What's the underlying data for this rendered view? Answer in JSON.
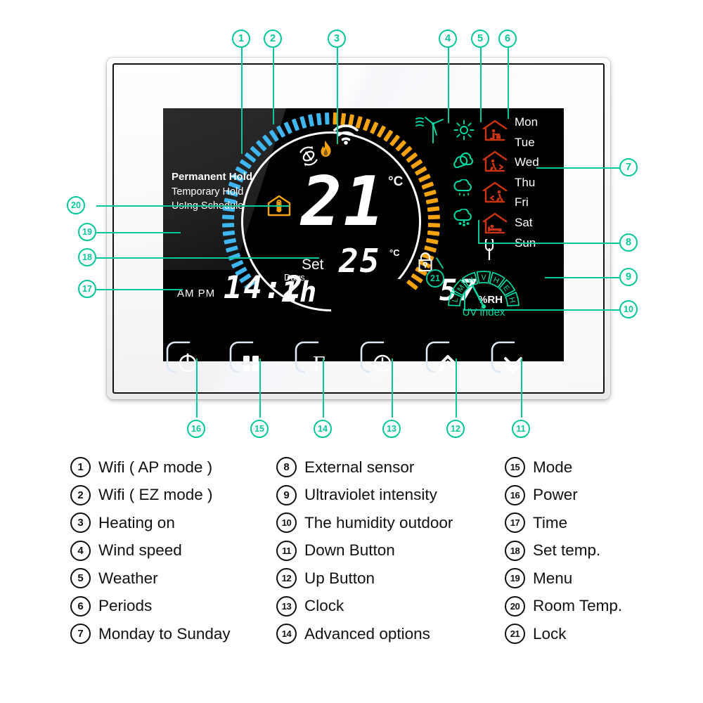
{
  "device": {
    "screen": {
      "room_temperature": "21",
      "room_temperature_unit": "°C",
      "set_label": "Set",
      "set_temperature": "25",
      "set_temperature_unit": "°C",
      "ampm_label": "AM PM",
      "clock_time": "14:2",
      "days_label": "Days",
      "days_value": "1h",
      "humidity_value": "57",
      "humidity_unit": "%RH",
      "uv_label": "UV index",
      "uv_scale": [
        "L",
        "M",
        "H",
        "V",
        "H",
        "E",
        "H"
      ],
      "menu_modes": [
        "Permanent Hold",
        "Temporary Hold",
        "UsIng Schedule"
      ],
      "weekdays": [
        "Mon",
        "Tue",
        "Wed",
        "Thu",
        "Fri",
        "Sat",
        "Sun"
      ],
      "weather_icons": [
        "sun-icon",
        "cloud-icon",
        "rain-cloud-icon",
        "snow-cloud-icon"
      ],
      "period_icons": [
        "period-wake-icon",
        "period-leave-icon",
        "period-return-icon",
        "period-sleep-icon"
      ],
      "status_icons": [
        "wifi-ap-mode-icon",
        "wifi-ez-mode-icon",
        "flame-heating-icon",
        "room-temp-house-icon",
        "wind-turbine-icon",
        "external-sensor-icon",
        "lock-icon"
      ]
    },
    "buttons": [
      {
        "name": "power-button",
        "icon": "power-icon",
        "label": ""
      },
      {
        "name": "mode-button",
        "icon": "grid-icon",
        "label": ""
      },
      {
        "name": "advanced-options-button",
        "icon": "f-icon",
        "label": "F"
      },
      {
        "name": "clock-button",
        "icon": "clock-icon",
        "label": ""
      },
      {
        "name": "up-button",
        "icon": "double-chevron-up-icon",
        "label": ""
      },
      {
        "name": "down-button",
        "icon": "double-chevron-down-icon",
        "label": ""
      }
    ]
  },
  "callouts": [
    "1",
    "2",
    "3",
    "4",
    "5",
    "6",
    "7",
    "8",
    "9",
    "10",
    "11",
    "12",
    "13",
    "14",
    "15",
    "16",
    "17",
    "18",
    "19",
    "20",
    "21"
  ],
  "legend": {
    "column1": [
      {
        "num": "1",
        "text": "Wifi ( AP mode )"
      },
      {
        "num": "2",
        "text": "Wifi ( EZ mode )"
      },
      {
        "num": "3",
        "text": "Heating on"
      },
      {
        "num": "4",
        "text": "Wind speed"
      },
      {
        "num": "5",
        "text": " Weather"
      },
      {
        "num": "6",
        "text": "Periods"
      },
      {
        "num": "7",
        "text": "Monday to Sunday"
      }
    ],
    "column2": [
      {
        "num": "8",
        "text": "External sensor"
      },
      {
        "num": "9",
        "text": "Ultraviolet intensity"
      },
      {
        "num": "10",
        "text": "The humidity outdoor"
      },
      {
        "num": "11",
        "text": "Down Button"
      },
      {
        "num": "12",
        "text": "Up Button"
      },
      {
        "num": "13",
        "text": "Clock"
      },
      {
        "num": "14",
        "text": "Advanced options"
      }
    ],
    "column3": [
      {
        "num": "15",
        "text": "Mode"
      },
      {
        "num": "16",
        "text": "Power"
      },
      {
        "num": "17",
        "text": "Time"
      },
      {
        "num": "18",
        "text": "Set temp."
      },
      {
        "num": "19",
        "text": "Menu"
      },
      {
        "num": "20",
        "text": "Room Temp."
      },
      {
        "num": "21",
        "text": "Lock"
      }
    ]
  },
  "colors": {
    "callout": "#06c79a",
    "cool_tick": "#3fb6ef",
    "warm_tick": "#f5a30c",
    "weather": "#00d9a3",
    "period": "#cc3311",
    "flame": "#f5a30c"
  }
}
